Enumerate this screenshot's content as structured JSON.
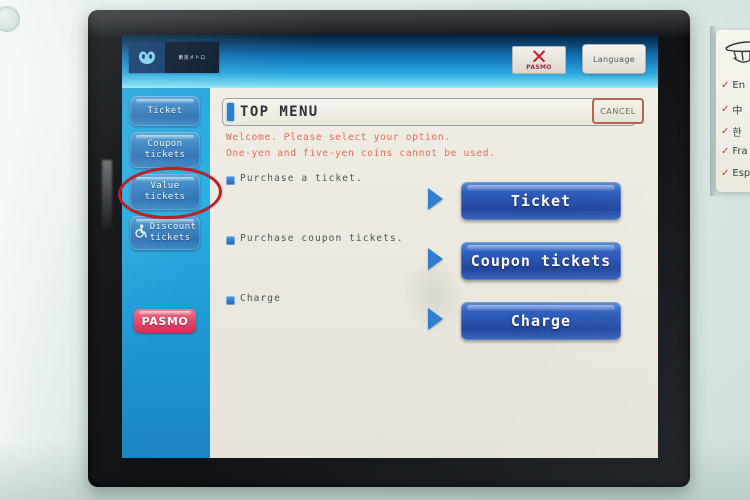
{
  "machine": {
    "brand": "Tokyo Metro",
    "metro_wordmark": "東京メトロ"
  },
  "header": {
    "pasmo_x_label": "PASMO",
    "pasmo_x_mark": "✕",
    "language_button": "Language"
  },
  "sidebar": {
    "items": [
      {
        "label": "Ticket",
        "line2": ""
      },
      {
        "label": "Coupon",
        "line2": "tickets"
      },
      {
        "label": "Value",
        "line2": "tickets"
      },
      {
        "label": "Discount",
        "line2": "tickets",
        "icon": "wheelchair-icon"
      }
    ],
    "pasmo_logo": "PASMO"
  },
  "main": {
    "title": "TOP MENU",
    "notices": [
      "Welcome. Please select your option.",
      "One-yen and five-yen coins cannot be used."
    ],
    "cancel_label": "CANCEL",
    "options": [
      {
        "label": "Purchase a ticket.",
        "button": "Ticket"
      },
      {
        "label": "Purchase coupon tickets.",
        "button": "Coupon tickets"
      },
      {
        "label": "Charge",
        "button": "Charge"
      }
    ]
  },
  "language_card": {
    "items": [
      {
        "check": "✓",
        "label": "En"
      },
      {
        "check": "✓",
        "label": "中"
      },
      {
        "check": "✓",
        "label": "한"
      },
      {
        "check": "✓",
        "label": "Fra"
      },
      {
        "check": "✓",
        "label": "Esp"
      }
    ]
  },
  "annotation": {
    "circled_target": "Value tickets",
    "color": "#b8202a"
  },
  "colors": {
    "accent_blue": "#1e7fd0",
    "button_blue": "#2f5fbf",
    "sidebar_blue": "#23a5dd",
    "notice_red": "#ef6a52",
    "pasmo_pink": "#e34f6e",
    "body_mint": "#e2ece8"
  }
}
